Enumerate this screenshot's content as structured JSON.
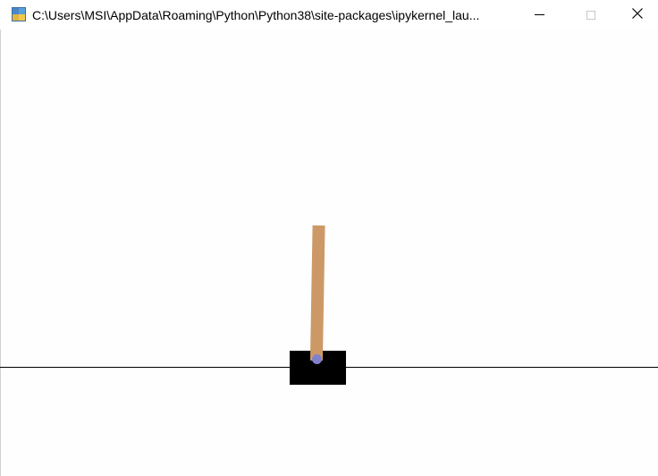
{
  "window": {
    "title": "C:\\Users\\MSI\\AppData\\Roaming\\Python\\Python38\\site-packages\\ipykernel_lau...",
    "app_icon": "python-icon",
    "controls": {
      "minimize_icon": "minimize-icon",
      "maximize_icon": "maximize-icon",
      "close_icon": "close-icon"
    }
  },
  "scene": {
    "name": "cartpole",
    "background": "#fefefe",
    "track_color": "#000000",
    "cart_color": "#000000",
    "pole_color": "#cc9966",
    "axle_color": "#8080cc",
    "pole_angle_deg": 1
  }
}
